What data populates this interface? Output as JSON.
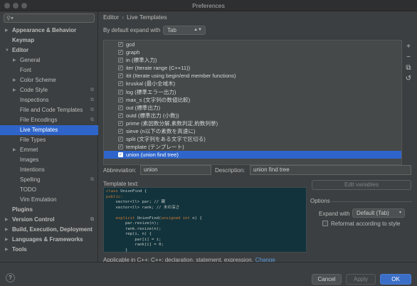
{
  "window": {
    "title": "Preferences"
  },
  "search": {
    "placeholder": ""
  },
  "sidebar": {
    "items": [
      {
        "label": "Appearance & Behavior",
        "indent": 0,
        "arrow": "▶",
        "bold": true
      },
      {
        "label": "Keymap",
        "indent": 0,
        "arrow": "",
        "bold": true
      },
      {
        "label": "Editor",
        "indent": 0,
        "arrow": "▼",
        "bold": true
      },
      {
        "label": "General",
        "indent": 1,
        "arrow": "▶",
        "bold": false
      },
      {
        "label": "Font",
        "indent": 1,
        "arrow": "",
        "bold": false
      },
      {
        "label": "Color Scheme",
        "indent": 1,
        "arrow": "▶",
        "bold": false
      },
      {
        "label": "Code Style",
        "indent": 1,
        "arrow": "▶",
        "bold": false,
        "project": true
      },
      {
        "label": "Inspections",
        "indent": 1,
        "arrow": "",
        "bold": false,
        "project": true
      },
      {
        "label": "File and Code Templates",
        "indent": 1,
        "arrow": "",
        "bold": false,
        "project": true
      },
      {
        "label": "File Encodings",
        "indent": 1,
        "arrow": "",
        "bold": false,
        "project": true
      },
      {
        "label": "Live Templates",
        "indent": 1,
        "arrow": "",
        "bold": false,
        "selected": true
      },
      {
        "label": "File Types",
        "indent": 1,
        "arrow": "",
        "bold": false
      },
      {
        "label": "Emmet",
        "indent": 1,
        "arrow": "▶",
        "bold": false
      },
      {
        "label": "Images",
        "indent": 1,
        "arrow": "",
        "bold": false
      },
      {
        "label": "Intentions",
        "indent": 1,
        "arrow": "",
        "bold": false
      },
      {
        "label": "Spelling",
        "indent": 1,
        "arrow": "",
        "bold": false,
        "project": true
      },
      {
        "label": "TODO",
        "indent": 1,
        "arrow": "",
        "bold": false
      },
      {
        "label": "Vim Emulation",
        "indent": 1,
        "arrow": "",
        "bold": false
      },
      {
        "label": "Plugins",
        "indent": 0,
        "arrow": "",
        "bold": true
      },
      {
        "label": "Version Control",
        "indent": 0,
        "arrow": "▶",
        "bold": true,
        "project": true
      },
      {
        "label": "Build, Execution, Deployment",
        "indent": 0,
        "arrow": "▶",
        "bold": true
      },
      {
        "label": "Languages & Frameworks",
        "indent": 0,
        "arrow": "▶",
        "bold": true
      },
      {
        "label": "Tools",
        "indent": 0,
        "arrow": "▶",
        "bold": true
      }
    ]
  },
  "breadcrumb": {
    "parent": "Editor",
    "separator": "›",
    "current": "Live Templates"
  },
  "expand": {
    "label": "By default expand with",
    "value": "Tab"
  },
  "templates": [
    {
      "abbr": "gcd",
      "checked": true
    },
    {
      "abbr": "graph",
      "checked": true
    },
    {
      "abbr": "in (標準入力)",
      "checked": true
    },
    {
      "abbr": "iter (Iterate range (C++11))",
      "checked": true
    },
    {
      "abbr": "itit (Iterate using begin/end member functions)",
      "checked": true
    },
    {
      "abbr": "kruskal (最小全域木)",
      "checked": true
    },
    {
      "abbr": "log (標準エラー出力)",
      "checked": true
    },
    {
      "abbr": "max_s (文字列の数値比較)",
      "checked": true
    },
    {
      "abbr": "out (標準出力)",
      "checked": true
    },
    {
      "abbr": "outd (標準出力 (小数))",
      "checked": true
    },
    {
      "abbr": "prime (素因数分解,素数判定,約数列挙)",
      "checked": true
    },
    {
      "abbr": "sieve (n以下の素数を高速に)",
      "checked": true
    },
    {
      "abbr": "split (文字列をある文字で区切る)",
      "checked": true
    },
    {
      "abbr": "template (テンプレート)",
      "checked": true
    },
    {
      "abbr": "union (union find tree)",
      "checked": true,
      "selected": true
    }
  ],
  "toolbar_icons": [
    "plus-icon",
    "minus-icon",
    "copy-icon",
    "restore-icon"
  ],
  "toolbar_glyphs": [
    "+",
    "−",
    "⧉",
    "↺"
  ],
  "abbreviation": {
    "label": "Abbreviation:",
    "value": "union"
  },
  "description": {
    "label": "Description:",
    "value": "union find tree"
  },
  "template_text": {
    "label": "Template text:",
    "lines": [
      "class UnionFind {",
      "public:",
      "    vector<ll> par; // 親",
      "    vector<ll> rank; // 木の深さ",
      "",
      "    explicit UnionFind(unsigned int n) {",
      "        par.resize(n);",
      "        rank.resize(n);",
      "        rep(i, n) {",
      "            par[i] = i;",
      "            rank[i] = 0;",
      "        }"
    ]
  },
  "edit_variables": "Edit variables",
  "options": {
    "title": "Options",
    "expand_with_label": "Expand with",
    "expand_with_value": "Default (Tab)",
    "reformat_label": "Reformat according to style"
  },
  "applicable": {
    "text": "Applicable in C++; C++: declaration, statement, expression.",
    "link": "Change"
  },
  "footer": {
    "help": "?",
    "cancel": "Cancel",
    "apply": "Apply",
    "ok": "OK"
  },
  "colors": {
    "selection": "#2f65ca",
    "background": "#3c3f41",
    "code_bg": "#13333c",
    "link": "#5c9fe0"
  }
}
